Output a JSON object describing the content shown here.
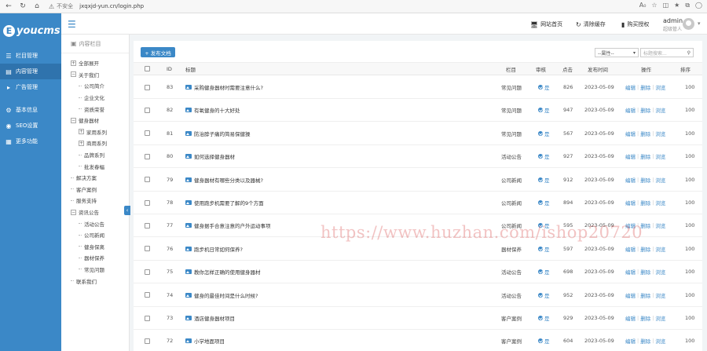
{
  "browser": {
    "insecure": "不安全",
    "url": "jxqxjd-yun.cn/login.php"
  },
  "logo": {
    "mark": "E",
    "text": "youcms"
  },
  "sidebar": {
    "items": [
      {
        "label": "栏目管理",
        "icon": "layers-icon",
        "active": false
      },
      {
        "label": "内容管理",
        "icon": "document-icon",
        "active": true
      },
      {
        "label": "广告管理",
        "icon": "megaphone-icon",
        "active": false
      },
      {
        "label": "基本信息",
        "icon": "gear-icon",
        "active": false
      },
      {
        "label": "SEO设置",
        "icon": "globe-icon",
        "active": false
      },
      {
        "label": "更多功能",
        "icon": "grid-icon",
        "active": false
      }
    ]
  },
  "tree": {
    "heading": "内容栏目",
    "nodes": [
      {
        "label": "全部展开",
        "level": 0,
        "toggle": "+"
      },
      {
        "label": "关于我们",
        "level": 0,
        "toggle": "−"
      },
      {
        "label": "公司简介",
        "level": 1
      },
      {
        "label": "企业文化",
        "level": 1
      },
      {
        "label": "资质荣誉",
        "level": 1
      },
      {
        "label": "健身器材",
        "level": 0,
        "toggle": "−"
      },
      {
        "label": "家用系列",
        "level": 1,
        "toggle": "+"
      },
      {
        "label": "商用系列",
        "level": 1,
        "toggle": "+"
      },
      {
        "label": "品牌系列",
        "level": 1
      },
      {
        "label": "批发春幅",
        "level": 1
      },
      {
        "label": "解决方案",
        "level": 0
      },
      {
        "label": "客户案例",
        "level": 0
      },
      {
        "label": "服务支持",
        "level": 0
      },
      {
        "label": "资讯公告",
        "level": 0,
        "toggle": "−"
      },
      {
        "label": "活动公告",
        "level": 1
      },
      {
        "label": "公司新闻",
        "level": 1
      },
      {
        "label": "健身保离",
        "level": 1
      },
      {
        "label": "器材保养",
        "level": 1
      },
      {
        "label": "常见问题",
        "level": 1
      },
      {
        "label": "联系我们",
        "level": 0
      }
    ]
  },
  "topbar": {
    "home_link": "网站首页",
    "clear_cache": "清除缓存",
    "buy_license": "购买授权",
    "user_name": "admin",
    "user_role": "超级管人"
  },
  "toolbar": {
    "add_label": "+ 发布文档",
    "select_value": "--属性--",
    "search_placeholder": "标题搜索..."
  },
  "table": {
    "headers": {
      "id": "ID",
      "title": "标题",
      "column": "栏目",
      "audit": "审核",
      "hits": "点击",
      "date": "发布时间",
      "ops": "操作",
      "sort": "排序"
    },
    "op_labels": {
      "edit": "编辑",
      "delete": "删除",
      "view": "浏览"
    },
    "rows": [
      {
        "id": "83",
        "title": "采购健身器材时需要注意什么?",
        "column": "常见问题",
        "audit": "是",
        "hits": "826",
        "date": "2023-05-09",
        "sort": "100"
      },
      {
        "id": "82",
        "title": "有氧健身的十大好处",
        "column": "常见问题",
        "audit": "是",
        "hits": "947",
        "date": "2023-05-09",
        "sort": "100"
      },
      {
        "id": "81",
        "title": "防治脖子痛的简易保健操",
        "column": "常见问题",
        "audit": "是",
        "hits": "567",
        "date": "2023-05-09",
        "sort": "100"
      },
      {
        "id": "80",
        "title": "如何选择健身器材",
        "column": "活动公告",
        "audit": "是",
        "hits": "927",
        "date": "2023-05-09",
        "sort": "100"
      },
      {
        "id": "79",
        "title": "健身器材有哪些分类以及器械?",
        "column": "公司新闻",
        "audit": "是",
        "hits": "912",
        "date": "2023-05-09",
        "sort": "100"
      },
      {
        "id": "78",
        "title": "使用跑步机需要了解的9个方面",
        "column": "公司新闻",
        "audit": "是",
        "hits": "894",
        "date": "2023-05-09",
        "sort": "100"
      },
      {
        "id": "77",
        "title": "健身据手合意注意的户外运动事项",
        "column": "公司新闻",
        "audit": "是",
        "hits": "595",
        "date": "2023-05-09",
        "sort": "100"
      },
      {
        "id": "76",
        "title": "跑步机日常如何保养?",
        "column": "器材保养",
        "audit": "是",
        "hits": "597",
        "date": "2023-05-09",
        "sort": "100"
      },
      {
        "id": "75",
        "title": "教你怎样正确的使用健身器材",
        "column": "活动公告",
        "audit": "是",
        "hits": "698",
        "date": "2023-05-09",
        "sort": "100"
      },
      {
        "id": "74",
        "title": "健身的最佳时间是什么时候?",
        "column": "活动公告",
        "audit": "是",
        "hits": "952",
        "date": "2023-05-09",
        "sort": "100"
      },
      {
        "id": "73",
        "title": "酒店健身器材项目",
        "column": "客户案例",
        "audit": "是",
        "hits": "929",
        "date": "2023-05-09",
        "sort": "100"
      },
      {
        "id": "72",
        "title": "小学地面项目",
        "column": "客户案例",
        "audit": "是",
        "hits": "604",
        "date": "2023-05-09",
        "sort": "100"
      }
    ]
  },
  "watermark": "https://www.huzhan.com/ishop20720"
}
